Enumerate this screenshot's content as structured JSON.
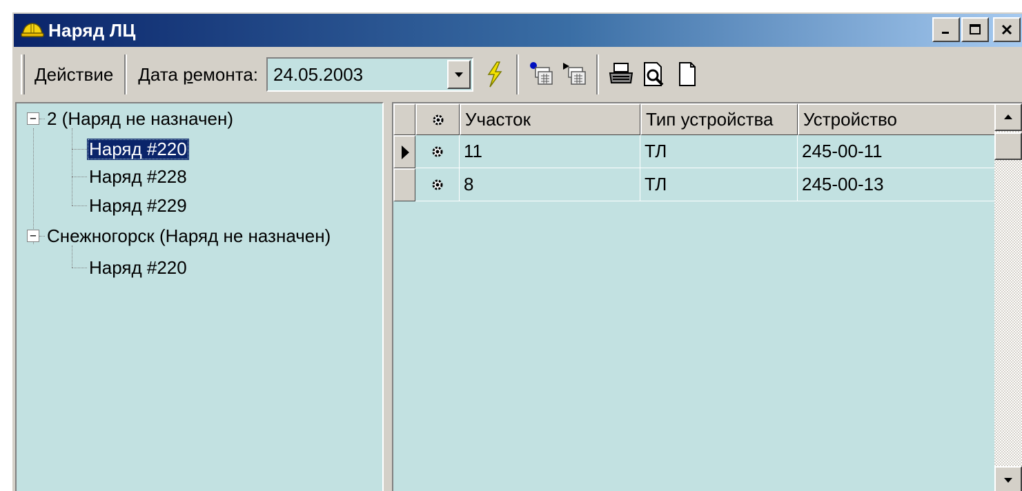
{
  "window": {
    "title": "Наряд ЛЦ",
    "icon": "hardhat-icon"
  },
  "toolbar": {
    "action_label": "Действие",
    "repair_date_label_pre": "Дата ",
    "repair_date_label_underlined": "р",
    "repair_date_label_post": "емонта:",
    "repair_date_value": "24.05.2003",
    "icons": [
      "lightning-icon",
      "add-record-icon",
      "play-record-icon",
      "printer-icon",
      "print-preview-icon",
      "new-document-icon"
    ]
  },
  "tree": {
    "groups": [
      {
        "label": "2 (Наряд не назначен)",
        "expanded": true,
        "children": [
          "Наряд #220",
          "Наряд #228",
          "Наряд #229"
        ]
      },
      {
        "label": "Снежногорск (Наряд не назначен)",
        "expanded": true,
        "children": [
          "Наряд #220"
        ]
      }
    ],
    "selected": "Наряд #220"
  },
  "grid": {
    "columns": [
      "Участок",
      "Тип устройства",
      "Устройство"
    ],
    "rows": [
      {
        "section": "11",
        "device_type": "ТЛ",
        "device": "245-00-11",
        "current": true
      },
      {
        "section": "8",
        "device_type": "ТЛ",
        "device": "245-00-13",
        "current": false
      }
    ]
  },
  "colors": {
    "panel_bg": "#c2e1e1",
    "title_start": "#0a246a",
    "title_end": "#a6caf0",
    "selection": "#0a246a"
  }
}
